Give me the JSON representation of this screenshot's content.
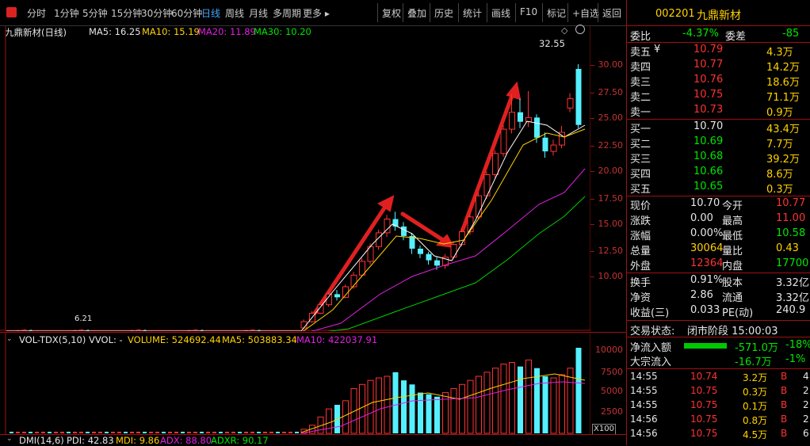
{
  "toolbar": {
    "periods": [
      "分时",
      "1分钟",
      "5分钟",
      "15分钟",
      "30分钟",
      "60分钟",
      "日线",
      "周线",
      "月线",
      "多周期",
      "更多 ▸"
    ],
    "active": "日线",
    "tools": [
      "复权",
      "叠加",
      "历史",
      "统计",
      "画线",
      "F10",
      "标记",
      "+自选",
      "返回"
    ]
  },
  "chart": {
    "title": "九鼎新材(日线)",
    "ma5": "MA5: 16.25",
    "ma10": "MA10: 15.19",
    "ma20": "MA20: 11.89",
    "ma30": "MA30: 10.20",
    "high_label": "32.55",
    "low_label": "6.21",
    "colors": {
      "ma5": "#ffffff",
      "ma10": "#ffd200",
      "ma20": "#e020e0",
      "ma30": "#00d000",
      "up": "#ff3232",
      "down": "#54f0ff"
    }
  },
  "price_axis": [
    "30.00",
    "27.50",
    "25.00",
    "22.50",
    "20.00",
    "17.50",
    "15.00",
    "12.50",
    "10.00"
  ],
  "volume": {
    "title": "VOL-TDX(5,10)",
    "vvol": "VVOL: -",
    "volume": "VOLUME: 524692.44",
    "ma5": "MA5: 503883.34",
    "ma10": "MA10: 422037.91",
    "axis": [
      "10000",
      "7500",
      "5000",
      "2500"
    ],
    "unit": "X100"
  },
  "dmi": {
    "title": "DMI(14,6)",
    "pdi": "PDI: 42.83",
    "mdi": "MDI: 9.86",
    "adx": "ADX: 88.80",
    "adxr": "ADXR: 90.17"
  },
  "quote": {
    "code": "002201",
    "name": "九鼎新材",
    "weibi_label": "委比",
    "weibi": "-4.37%",
    "weicha_label": "委差",
    "weicha": "-85",
    "asks": [
      {
        "label": "卖五",
        "mark": "¥",
        "price": "10.79",
        "vol": "4.3万"
      },
      {
        "label": "卖四",
        "mark": "",
        "price": "10.77",
        "vol": "14.2万"
      },
      {
        "label": "卖三",
        "mark": "",
        "price": "10.76",
        "vol": "18.6万"
      },
      {
        "label": "卖二",
        "mark": "",
        "price": "10.75",
        "vol": "71.1万"
      },
      {
        "label": "卖一",
        "mark": "",
        "price": "10.73",
        "vol": "0.9万"
      }
    ],
    "bids": [
      {
        "label": "买一",
        "price": "10.70",
        "vol": "43.4万"
      },
      {
        "label": "买二",
        "price": "10.69",
        "vol": "7.7万"
      },
      {
        "label": "买三",
        "price": "10.68",
        "vol": "39.2万"
      },
      {
        "label": "买四",
        "price": "10.66",
        "vol": "8.6万"
      },
      {
        "label": "买五",
        "price": "10.65",
        "vol": "0.3万"
      }
    ],
    "stats": [
      {
        "l1": "现价",
        "v1": "10.70",
        "l2": "今开",
        "v2": "10.77",
        "c1": "white",
        "c2": "red"
      },
      {
        "l1": "涨跌",
        "v1": "0.00",
        "l2": "最高",
        "v2": "11.00",
        "c1": "white",
        "c2": "red"
      },
      {
        "l1": "涨幅",
        "v1": "0.00%",
        "l2": "最低",
        "v2": "10.58",
        "c1": "white",
        "c2": "green"
      },
      {
        "l1": "总量",
        "v1": "30064",
        "l2": "量比",
        "v2": "0.43",
        "c1": "yellow",
        "c2": "yellow"
      },
      {
        "l1": "外盘",
        "v1": "12364",
        "l2": "内盘",
        "v2": "17700",
        "c1": "red",
        "c2": "green"
      }
    ],
    "stats2": [
      {
        "l1": "换手",
        "v1": "0.91%",
        "l2": "股本",
        "v2": "3.32亿"
      },
      {
        "l1": "净资",
        "v1": "2.86",
        "l2": "流通",
        "v2": "3.32亿"
      },
      {
        "l1": "收益(三)",
        "v1": "0.033",
        "l2": "PE(动)",
        "v2": "240.9"
      }
    ],
    "status_label": "交易状态:",
    "status": "闭市阶段 15:00:03",
    "flow": [
      {
        "label": "净流入额",
        "value": "-571.0万",
        "pct": "-18%"
      },
      {
        "label": "大宗流入",
        "value": "-16.7万",
        "pct": "-1%"
      }
    ],
    "ticks": [
      {
        "time": "14:55",
        "price": "10.74",
        "vol": "3.2万",
        "side": "B",
        "extra": "4"
      },
      {
        "time": "14:55",
        "price": "10.75",
        "vol": "0.3万",
        "side": "B",
        "extra": "2"
      },
      {
        "time": "14:55",
        "price": "10.75",
        "vol": "0.1万",
        "side": "B",
        "extra": "2"
      },
      {
        "time": "14:56",
        "price": "10.75",
        "vol": "0.8万",
        "side": "B",
        "extra": "2"
      },
      {
        "time": "14:56",
        "price": "10.75",
        "vol": "4.5万",
        "side": "B",
        "extra": "6"
      }
    ]
  }
}
